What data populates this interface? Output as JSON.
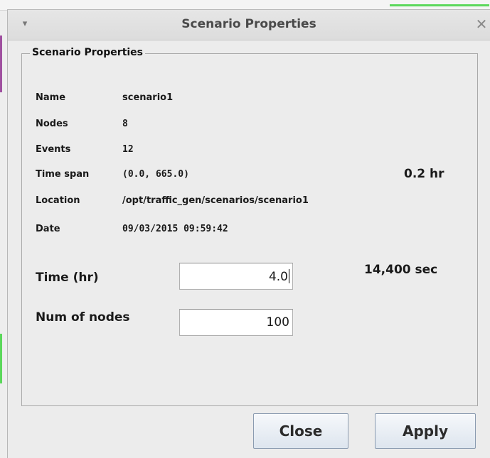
{
  "window": {
    "title": "Scenario Properties",
    "menu_icon": "▾",
    "close_icon": "✕"
  },
  "group": {
    "legend": "Scenario Properties"
  },
  "properties": [
    {
      "label": "Name",
      "value": "scenario1"
    },
    {
      "label": "Nodes",
      "value": "8"
    },
    {
      "label": "Events",
      "value": "12"
    },
    {
      "label": "Time span",
      "value": "(0.0, 665.0)"
    },
    {
      "label": "Location",
      "value": "/opt/traffic_gen/scenarios/scenario1"
    },
    {
      "label": "Date",
      "value": "09/03/2015 09:59:42"
    }
  ],
  "timespan_hours": "0.2 hr",
  "time_field": {
    "label": "Time (hr)",
    "value": "4.0",
    "seconds": "14,400 sec"
  },
  "nodes_field": {
    "label": "Num of nodes",
    "value": "100"
  },
  "buttons": {
    "close_label": "Close",
    "apply_label": "Apply"
  },
  "colors": {
    "button_border": "#8a9bb0",
    "dialog_bg": "#ececec"
  }
}
